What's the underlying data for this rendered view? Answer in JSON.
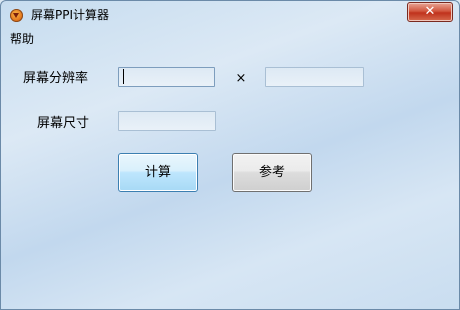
{
  "window": {
    "title": "屏幕PPI计算器",
    "close_glyph": "✕",
    "app_icon": "app-logo-icon"
  },
  "menu": {
    "help": "帮助"
  },
  "form": {
    "resolution_label": "屏幕分辨率",
    "times_sign": "×",
    "size_label": "屏幕尺寸",
    "width_value": "",
    "height_value": "",
    "size_value": ""
  },
  "buttons": {
    "calculate": "计算",
    "reference": "参考"
  },
  "colors": {
    "primary_button_border": "#3c7fb1",
    "close_button": "#c0321c"
  }
}
